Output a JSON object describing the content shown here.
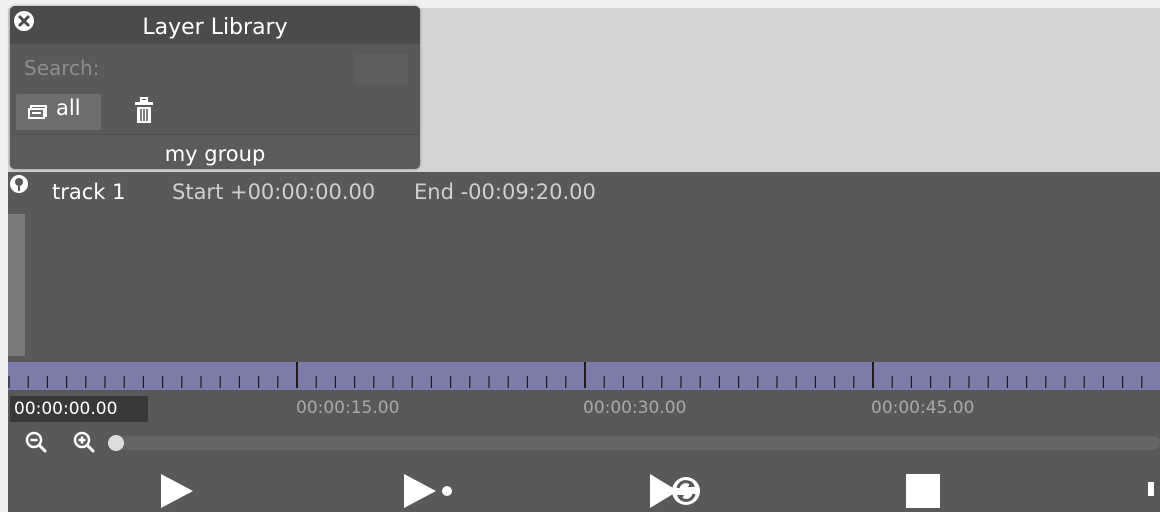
{
  "library": {
    "title": "Layer Library",
    "search_label": "Search:",
    "search_value": "",
    "all_label": "all",
    "group_label": "my group"
  },
  "track": {
    "name": "track 1",
    "start": "Start +00:00:00.00",
    "end": "End -00:09:20.00"
  },
  "timeline": {
    "timecodes": [
      "00:00:00.00",
      "00:00:15.00",
      "00:00:30.00",
      "00:00:45.00"
    ],
    "zoom_level": 0
  },
  "icons": {
    "close": "close-icon",
    "all": "layers-icon",
    "trash": "trash-icon",
    "track": "pin-icon",
    "zoom_out": "zoom-out-icon",
    "zoom_in": "zoom-in-icon",
    "play": "play-icon",
    "play_once": "play-once-icon",
    "loop": "loop-icon",
    "stop": "stop-icon"
  },
  "colors": {
    "panel": "#595959",
    "ruler": "#7c7ca8",
    "canvas": "#d4d4d4"
  }
}
